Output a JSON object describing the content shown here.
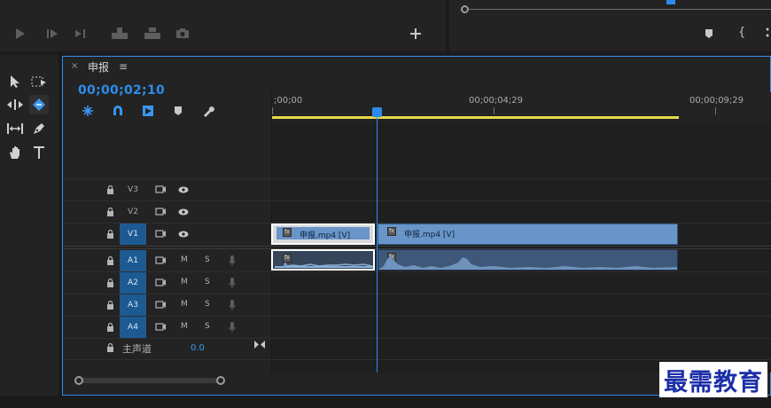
{
  "sequence": {
    "tab_title": "申报",
    "close_glyph": "×",
    "menu_glyph": "≡",
    "timecode": "00;00;02;10"
  },
  "ruler": {
    "labels": [
      ";00;00",
      "00;00;04;29",
      "00;00;09;29"
    ]
  },
  "tracks": {
    "video": [
      {
        "label": "V3",
        "targeted": false
      },
      {
        "label": "V2",
        "targeted": false
      },
      {
        "label": "V1",
        "targeted": true
      }
    ],
    "audio": [
      {
        "label": "A1",
        "targeted": true,
        "mute": "M",
        "solo": "S"
      },
      {
        "label": "A2",
        "targeted": true,
        "mute": "M",
        "solo": "S"
      },
      {
        "label": "A3",
        "targeted": true,
        "mute": "M",
        "solo": "S"
      },
      {
        "label": "A4",
        "targeted": true,
        "mute": "M",
        "solo": "S"
      }
    ],
    "master": {
      "label": "主声道",
      "value": "0.0"
    }
  },
  "clips": [
    {
      "name": "申报.mp4 [V]",
      "fx": "fx",
      "selected": true
    },
    {
      "name": "申报.mp4 [V]",
      "fx": "fx",
      "selected": false
    }
  ],
  "tools": [
    "selection-tool",
    "track-select-tool",
    "ripple-edit-tool",
    "razor-tool",
    "slip-tool",
    "pen-tool",
    "hand-tool",
    "type-tool"
  ],
  "watermark": "最需教育",
  "colors": {
    "accent": "#2d8ceb",
    "clip_video": "#6a95c8",
    "clip_audio": "#3f5778",
    "work_area": "#e8d84a",
    "track_target": "#1d5a92"
  }
}
